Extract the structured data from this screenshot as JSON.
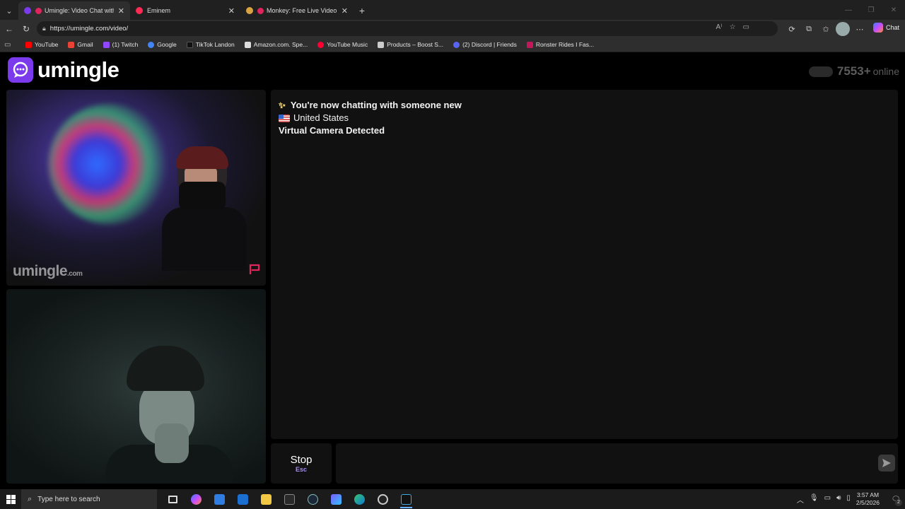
{
  "browser": {
    "tabs": [
      {
        "title": "Umingle: Video Chat with Stra",
        "favicon_color": "#7c3aed",
        "active": true
      },
      {
        "title": "Eminem",
        "favicon_color": "#ff2b55",
        "active": false
      },
      {
        "title": "Monkey: Free Live Video Chat",
        "favicon_color": "#d9a441",
        "active": false
      }
    ],
    "url": "https://umingle.com/video/",
    "copilot_label": "Chat",
    "bookmarks": [
      {
        "label": "YouTube",
        "color": "#ff0000"
      },
      {
        "label": "Gmail",
        "color": "#ea4335"
      },
      {
        "label": "(1) Twitch",
        "color": "#9146ff"
      },
      {
        "label": "Google",
        "color": "#4285f4"
      },
      {
        "label": "TikTok Landon",
        "color": "#111111"
      },
      {
        "label": "Amazon.com. Spe...",
        "color": "#dddddd"
      },
      {
        "label": "YouTube Music",
        "color": "#ff0033"
      },
      {
        "label": "Products – Boost S...",
        "color": "#cccccc"
      },
      {
        "label": "(2) Discord | Friends",
        "color": "#5865f2"
      },
      {
        "label": "Ronster Rides I Fas...",
        "color": "#c2185b"
      }
    ]
  },
  "site": {
    "brand": "umingle",
    "online_count": "7553+",
    "online_label": "online",
    "watermark_main": "umingle",
    "watermark_suffix": ".com",
    "brand_color": "#7c3aed"
  },
  "chat": {
    "messages": [
      {
        "icon": "sparkles-icon",
        "text": "You're now chatting with someone new"
      },
      {
        "icon": "us-flag-icon",
        "text": "United States"
      },
      {
        "icon": "",
        "text": "Virtual Camera Detected"
      }
    ],
    "stop_label": "Stop",
    "stop_key": "Esc",
    "input_value": ""
  },
  "taskbar": {
    "search_placeholder": "Type here to search",
    "time": "3:57 AM",
    "date": "2/5/2026",
    "notification_count": "2"
  }
}
